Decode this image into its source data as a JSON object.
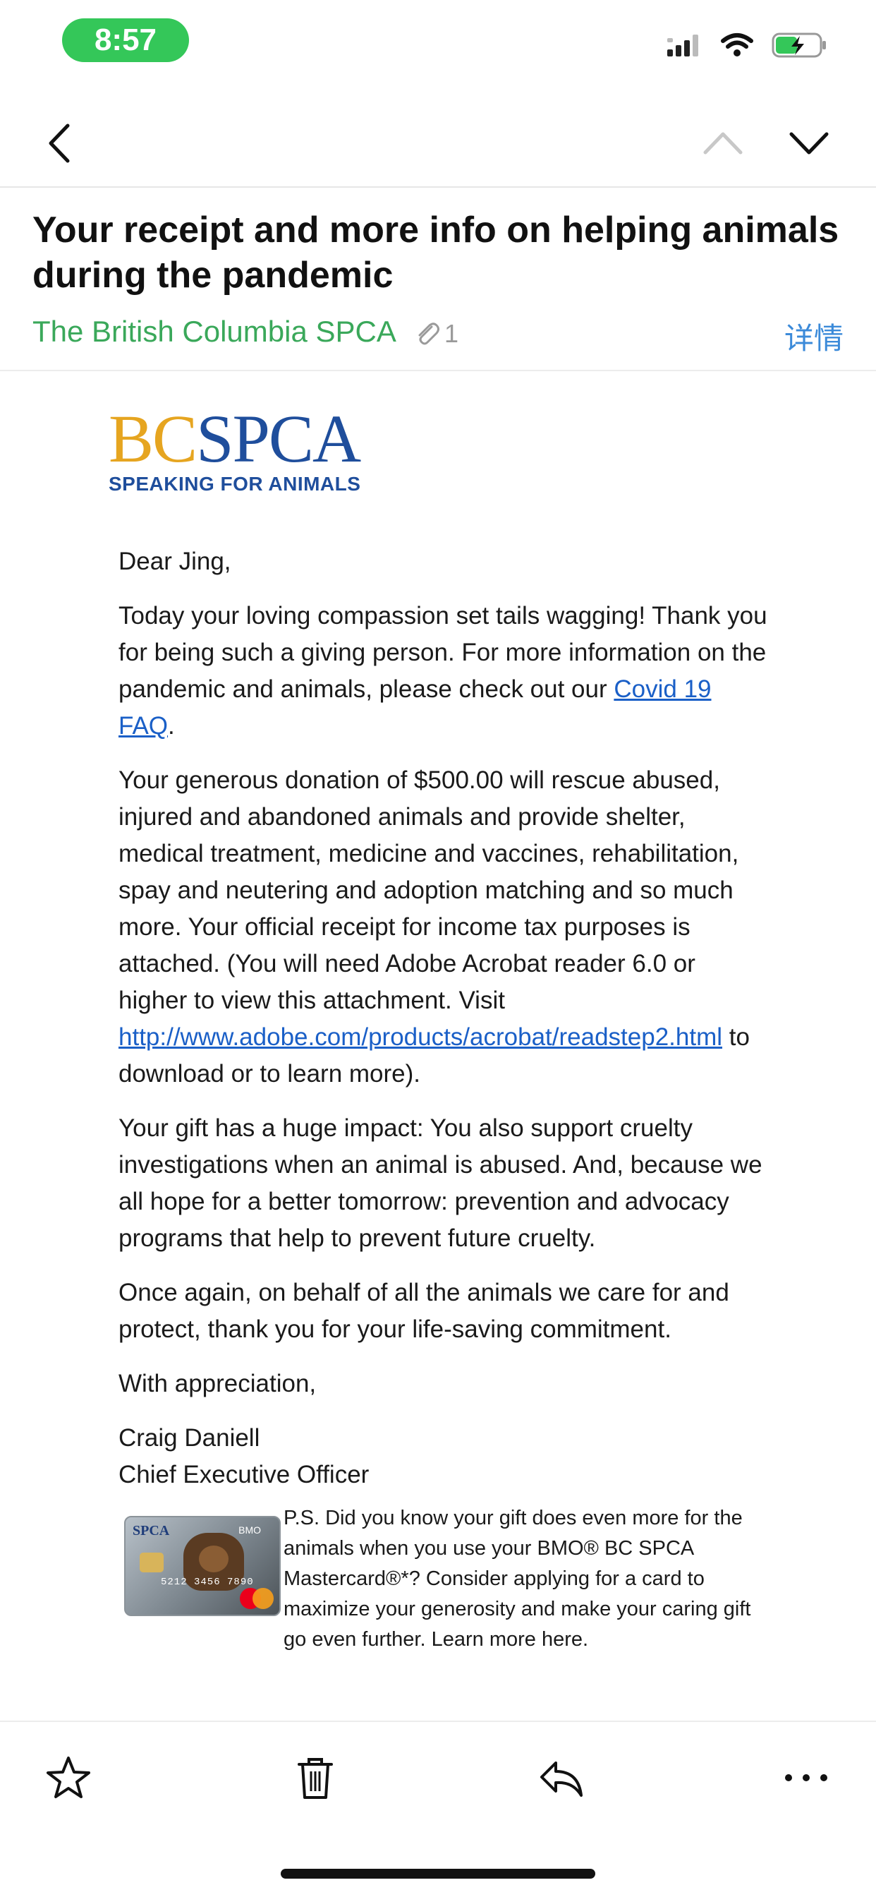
{
  "status": {
    "time": "8:57"
  },
  "email": {
    "subject": "Your receipt and more info on helping animals during the pandemic",
    "sender": "The British Columbia SPCA",
    "attachment_count": "1",
    "details_label": "详情"
  },
  "logo": {
    "bc": "BC",
    "spca": "SPCA",
    "tagline": "SPEAKING FOR ANIMALS"
  },
  "body": {
    "greeting": "Dear Jing,",
    "p1_text": "Today your loving compassion set tails wagging! Thank you for being such a giving person. For more information on the pandemic and animals, please check out our ",
    "p1_link": "Covid 19 FAQ",
    "p1_end": ".",
    "p2_text": "Your generous donation of $500.00 will rescue abused, injured and abandoned animals and provide shelter, medical treatment, medicine and vaccines, rehabilitation, spay and neutering and adoption matching and so much more. Your official receipt for income tax purposes is attached. (You will need Adobe Acrobat reader 6.0 or higher to view this attachment. Visit ",
    "p2_link": "http://www.adobe.com/products/acrobat/readstep2.html",
    "p2_end": " to download or to learn more).",
    "p3": "Your gift has a huge impact: You also support cruelty investigations when an animal is abused. And, because we all hope for a better tomorrow: prevention and advocacy programs that help to prevent future cruelty.",
    "p4": "Once again, on behalf of all the animals we care for and protect, thank you for your life-saving commitment.",
    "closing": "With appreciation,",
    "signer_name": "Craig Daniell",
    "signer_title": "Chief Executive Officer",
    "ps": "P.S. Did you know your gift does even more for the animals when you use your BMO® BC SPCA Mastercard®*? Consider applying for a card to maximize your generosity and make your caring gift go even further. Learn more here."
  },
  "card": {
    "logo": "SPCA",
    "bank": "BMO",
    "number": "5212 3456 7890"
  },
  "icons": {
    "back": "chevron-left-icon",
    "prev": "chevron-up-icon",
    "next": "chevron-down-icon",
    "star": "star-icon",
    "trash": "trash-icon",
    "reply": "reply-icon",
    "more": "more-icon"
  },
  "colors": {
    "time_pill": "#34c759",
    "sender": "#3aa85a",
    "details": "#3b8ad9",
    "link": "#1a5fc7",
    "logo_bc": "#e6a520",
    "logo_spca": "#1f4e9c"
  }
}
